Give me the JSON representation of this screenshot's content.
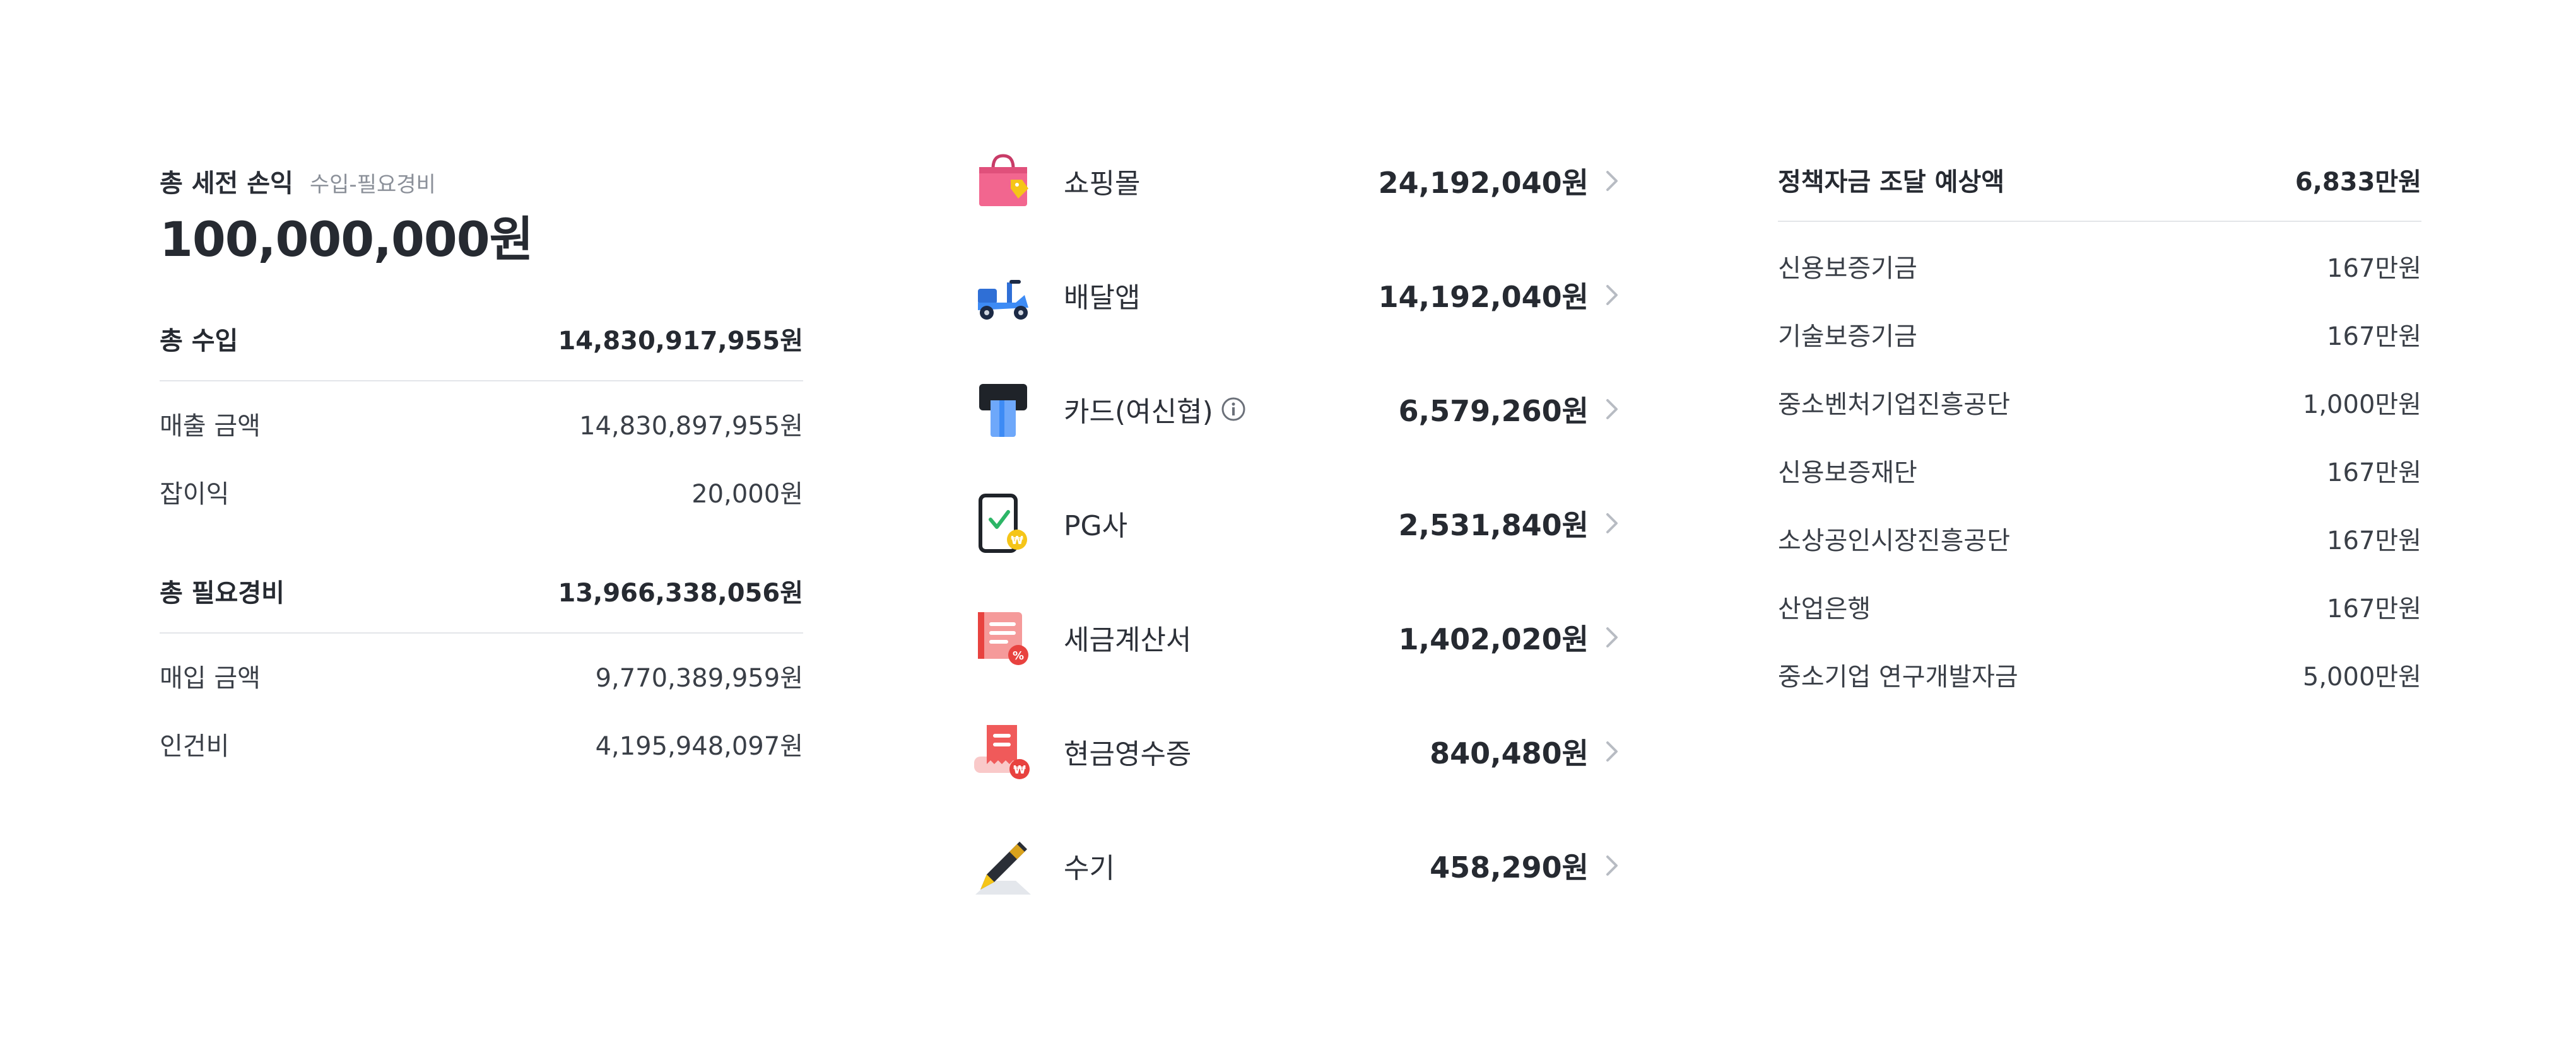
{
  "profit_loss": {
    "title": "총 세전 손익",
    "subtitle": "수입-필요경비",
    "amount": "100,000,000원",
    "income": {
      "label": "총 수입",
      "amount": "14,830,917,955원",
      "items": [
        {
          "label": "매출 금액",
          "amount": "14,830,897,955원"
        },
        {
          "label": "잡이익",
          "amount": "20,000원"
        }
      ]
    },
    "expense": {
      "label": "총 필요경비",
      "amount": "13,966,338,056원",
      "items": [
        {
          "label": "매입 금액",
          "amount": "9,770,389,959원"
        },
        {
          "label": "인건비",
          "amount": "4,195,948,097원"
        }
      ]
    }
  },
  "channels": [
    {
      "label": "쇼핑몰",
      "amount": "24,192,040원",
      "icon": "shopping-bag-icon"
    },
    {
      "label": "배달앱",
      "amount": "14,192,040원",
      "icon": "delivery-scooter-icon"
    },
    {
      "label": "카드(여신협)",
      "amount": "6,579,260원",
      "icon": "card-terminal-icon",
      "info_icon": "info-icon"
    },
    {
      "label": "PG사",
      "amount": "2,531,840원",
      "icon": "mobile-payment-icon"
    },
    {
      "label": "세금계산서",
      "amount": "1,402,020원",
      "icon": "tax-invoice-icon"
    },
    {
      "label": "현금영수증",
      "amount": "840,480원",
      "icon": "cash-receipt-icon"
    },
    {
      "label": "수기",
      "amount": "458,290원",
      "icon": "pen-icon"
    }
  ],
  "policy_fund": {
    "title": "정책자금 조달 예상액",
    "total": "6,833만원",
    "items": [
      {
        "label": "신용보증기금",
        "amount": "167만원"
      },
      {
        "label": "기술보증기금",
        "amount": "167만원"
      },
      {
        "label": "중소벤처기업진흥공단",
        "amount": "1,000만원"
      },
      {
        "label": "신용보증재단",
        "amount": "167만원"
      },
      {
        "label": "소상공인시장진흥공단",
        "amount": "167만원"
      },
      {
        "label": "산업은행",
        "amount": "167만원"
      },
      {
        "label": "중소기업 연구개발자금",
        "amount": "5,000만원"
      }
    ]
  },
  "colors": {
    "text_primary": "#262a31",
    "text_secondary": "#8b9099",
    "divider": "#e3e5e9",
    "chevron": "#b8bcc3",
    "accent_pink": "#f2668f",
    "accent_blue": "#3d8bf5",
    "accent_red": "#e8423f",
    "accent_yellow": "#f5c518",
    "accent_green": "#2cb566"
  }
}
